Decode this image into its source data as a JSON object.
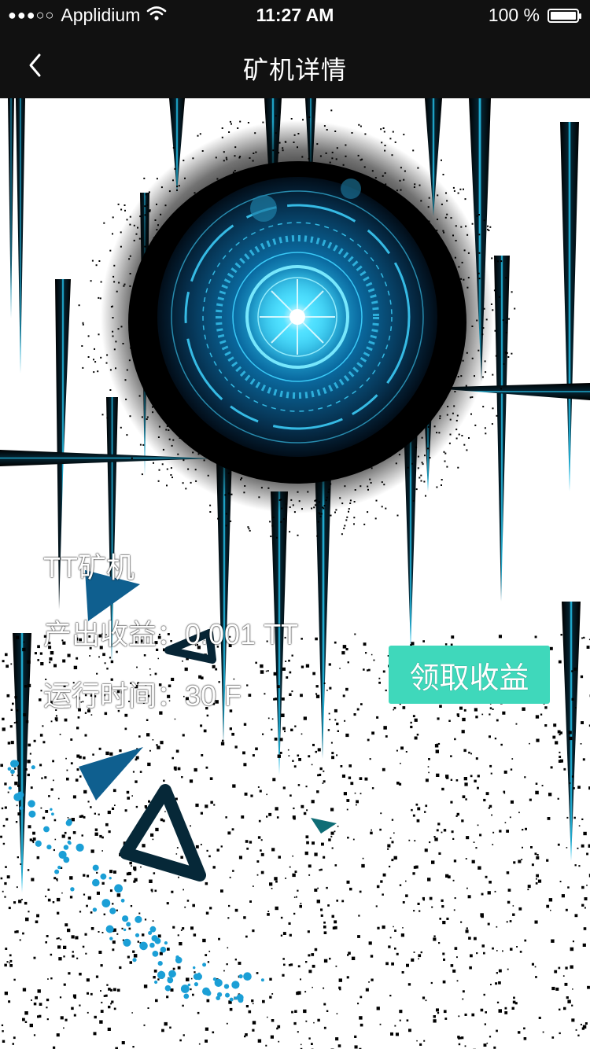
{
  "status_bar": {
    "signal_dots": "●●●○○",
    "carrier": "Applidium",
    "wifi_icon": "wifi-icon",
    "time": "11:27 AM",
    "battery_text": "100 %",
    "battery_level": 1.0
  },
  "nav": {
    "back_icon": "chevron-left-icon",
    "title": "矿机详情"
  },
  "miner": {
    "name": "TT矿机",
    "output_label": "产出收益：",
    "output_value": "0.001 TT",
    "runtime_label": "运行时间：",
    "runtime_value": "30 F"
  },
  "claim_button": {
    "label": "领取收益",
    "color": "#3fd8bb"
  },
  "theme": {
    "bar_color": "#111111",
    "glow_color": "#19c4f0"
  }
}
